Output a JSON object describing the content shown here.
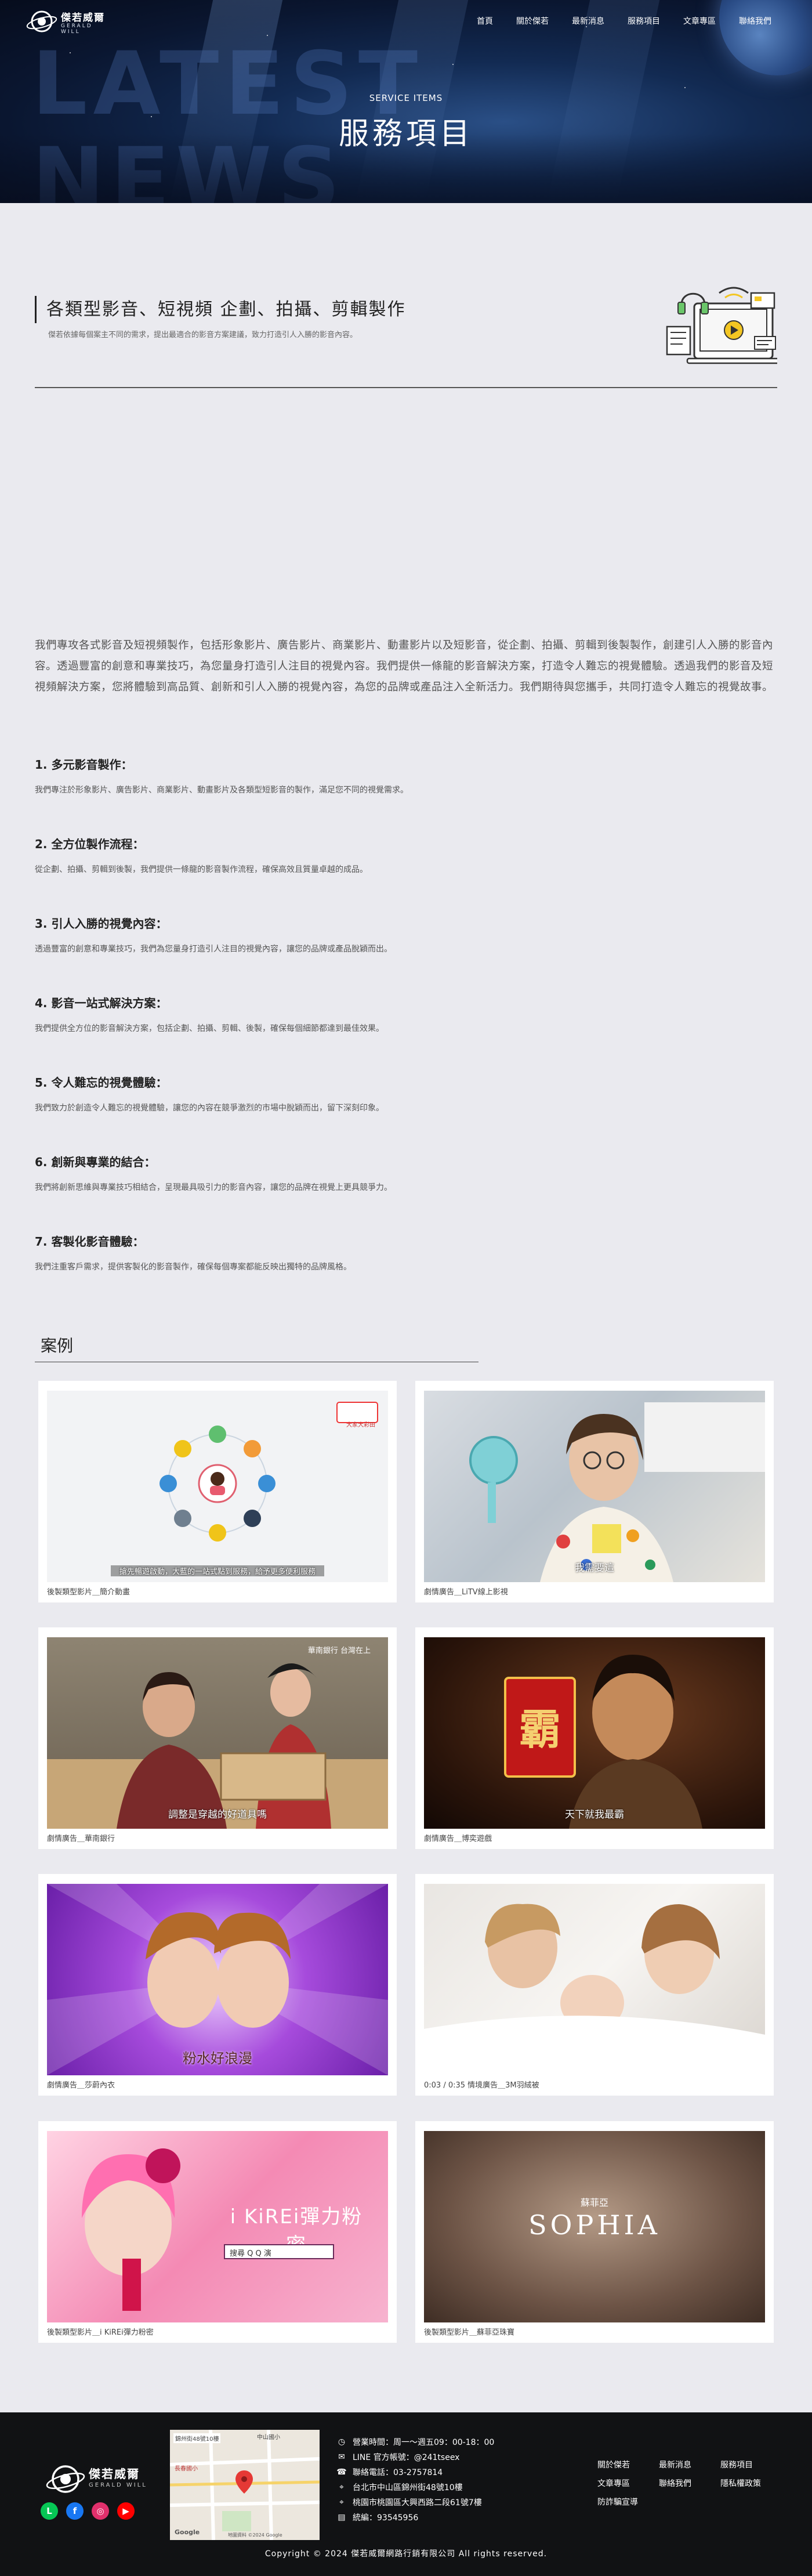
{
  "header": {
    "logo_name": "傑若威爾",
    "logo_sub": "GERALD WILL",
    "menu": [
      "首頁",
      "關於傑若",
      "最新消息",
      "服務項目",
      "文章專區",
      "聯絡我們"
    ]
  },
  "hero": {
    "bg_line1": "LATEST",
    "bg_line2": "NEWS",
    "eyebrow": "SERVICE ITEMS",
    "title": "服務項目"
  },
  "section": {
    "title": "各類型影音、短視頻 企劃、拍攝、剪輯製作",
    "desc": "傑若依據每個案主不同的需求，提出最適合的影音方案建議，致力打造引人入勝的影音內容。"
  },
  "intro": "我們專攻各式影音及短視頻製作，包括形象影片、廣告影片、商業影片、動畫影片以及短影音，從企劃、拍攝、剪輯到後製製作，創建引人入勝的影音內容。透過豐富的創意和專業技巧，為您量身打造引人注目的視覺內容。我們提供一條龍的影音解決方案，打造令人難忘的視覺體驗。透過我們的影音及短視頻解決方案，您將體驗到高品質、創新和引人入勝的視覺內容，為您的品牌或產品注入全新活力。我們期待與您攜手，共同打造令人難忘的視覺故事。",
  "points": [
    {
      "title": "1. 多元影音製作：",
      "desc": "我們專注於形象影片、廣告影片、商業影片、動畫影片及各類型短影音的製作，滿足您不同的視覺需求。"
    },
    {
      "title": "2. 全方位製作流程：",
      "desc": "從企劃、拍攝、剪輯到後製，我們提供一條龍的影音製作流程，確保高效且質量卓越的成品。"
    },
    {
      "title": "3. 引人入勝的視覺內容：",
      "desc": "透過豐富的創意和專業技巧，我們為您量身打造引人注目的視覺內容，讓您的品牌或產品脫穎而出。"
    },
    {
      "title": "4. 影音一站式解決方案：",
      "desc": "我們提供全方位的影音解決方案，包括企劃、拍攝、剪輯、後製，確保每個細節都達到最佳效果。"
    },
    {
      "title": "5. 令人難忘的視覺體驗：",
      "desc": "我們致力於創造令人難忘的視覺體驗，讓您的內容在競爭激烈的市場中脫穎而出，留下深刻印象。"
    },
    {
      "title": "6. 創新與專業的結合：",
      "desc": "我們將創新思維與專業技巧相結合，呈現最具吸引力的影音內容，讓您的品牌在視覺上更具競爭力。"
    },
    {
      "title": "7. 客製化影音體驗：",
      "desc": "我們注重客戶需求，提供客製化的影音製作，確保每個專案都能反映出獨特的品牌風格。"
    }
  ],
  "cases": {
    "title": "案例",
    "items": [
      {
        "caption": "後製類型影片＿簡介動畫",
        "overlay": "搶先暢遊啟動，大藍的一站式點到服務，給予更多便利服務",
        "badge": "大家大彩田"
      },
      {
        "caption": "劇情廣告＿LiTV線上影視",
        "overlay": "我需要這",
        "badge": ""
      },
      {
        "caption": "劇情廣告＿華南銀行",
        "overlay": "調整是穿越的好道具嗎",
        "badge": "華南銀行 台灣在上"
      },
      {
        "caption": "劇情廣告＿博奕遊戲",
        "overlay": "天下就我最霸",
        "badge": "霸"
      },
      {
        "caption": "劇情廣告＿莎蔚內衣",
        "overlay": "粉水好浪漫",
        "badge": ""
      },
      {
        "caption": "0:03 / 0:35 情境廣告＿3M羽絨被",
        "overlay": "",
        "badge": ""
      },
      {
        "caption": "後製類型影片＿i KiREi彈力粉密",
        "overlay": "i KiREi彈力粉密",
        "badge": "搜尋 Q Q 演"
      },
      {
        "caption": "後製類型影片＿蘇菲亞珠寶",
        "overlay": "SOPHIA",
        "badge": "蘇菲亞"
      }
    ]
  },
  "footer": {
    "logo_name": "傑若威爾",
    "logo_sub": "GERALD WILL",
    "socials": [
      "line-icon",
      "facebook-icon",
      "instagram-icon",
      "youtube-icon"
    ],
    "contact": [
      "營業時間：周一～週五09：00-18：00",
      "LINE 官方帳號：@241tseex",
      "聯絡電話：03-2757814",
      "台北市中山區錦州街48號10樓",
      "桃園市桃園區大興西路二段61號7樓",
      "統編：93545956"
    ],
    "links": [
      "關於傑若",
      "最新消息",
      "服務項目",
      "文章專區",
      "聯絡我們",
      "隱私權政策",
      "防詐騙宣導"
    ],
    "map_labels": [
      "錦州街48號10樓",
      "中山國小",
      "長春國小",
      "Google",
      "地圖資料 ©2024 Google"
    ],
    "copyright": "Copyright © 2024 傑若威爾網路行銷有限公司 All rights reserved."
  },
  "colors": {
    "hero_bg": "#0a1630",
    "page_bg": "#eaeaef",
    "footer_bg": "#111214",
    "line_green": "#06c755",
    "facebook_blue": "#1877f2",
    "instagram_pink": "#e1306c",
    "youtube_red": "#ff0000"
  }
}
